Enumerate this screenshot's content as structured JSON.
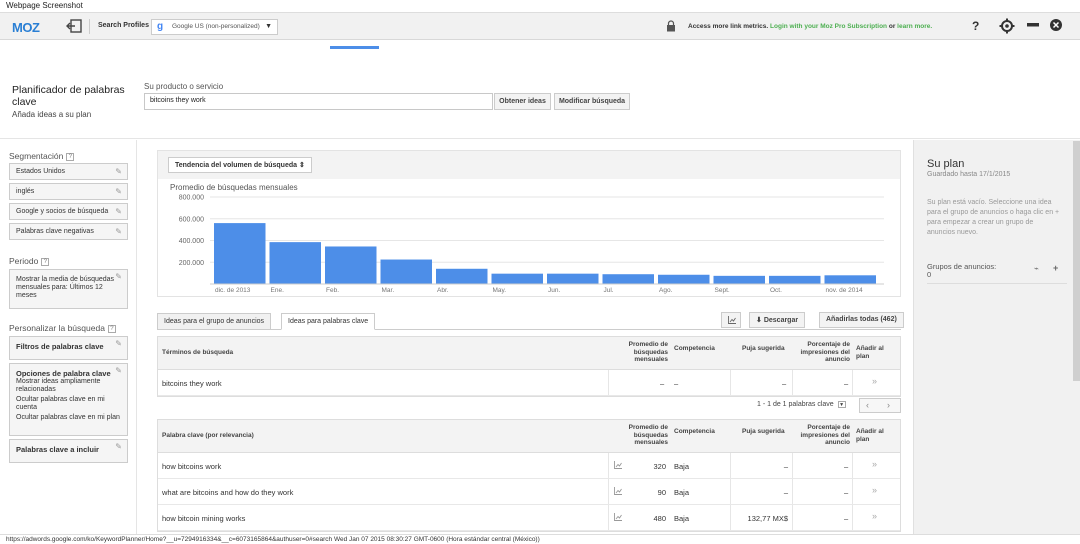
{
  "window": {
    "title": "Webpage Screenshot"
  },
  "moz": {
    "logo": "MOZ",
    "search_profiles_label": "Search Profiles",
    "profile_value": "Google US (non-personalized)",
    "access_prefix": "Access more link metrics.",
    "access_link": "Login with your Moz Pro Subscription",
    "access_or": "or",
    "access_learn": "learn more.",
    "help": "?"
  },
  "header": {
    "planner_title": "Planificador de palabras clave",
    "planner_subtitle": "Añada ideas a su plan",
    "product_label": "Su producto o servicio",
    "product_value": "bitcoins they work",
    "get_ideas": "Obtener ideas",
    "modify_search": "Modificar búsqueda"
  },
  "sidebar": {
    "segmentation_label": "Segmentación",
    "segments": [
      "Estados Unidos",
      "inglés",
      "Google y socios de búsqueda",
      "Palabras clave negativas"
    ],
    "period_label": "Periodo",
    "period_value": "Mostrar la media de búsquedas mensuales para: Últimos 12 meses",
    "customize_label": "Personalizar la búsqueda",
    "keyword_filters": "Filtros de palabras clave",
    "keyword_options": "Opciones de palabra clave",
    "options": [
      "Mostrar ideas ampliamente relacionadas",
      "Ocultar palabras clave en mi cuenta",
      "Ocultar palabras clave en mi plan"
    ],
    "keywords_to_include": "Palabras clave a incluir"
  },
  "chart_panel": {
    "trend_button": "Tendencia del volumen de búsqueda"
  },
  "chart_data": {
    "type": "bar",
    "title": "Promedio de búsquedas mensuales",
    "categories": [
      "dic. de 2013",
      "Ene.",
      "Feb.",
      "Mar.",
      "Abr.",
      "May.",
      "Jun.",
      "Jul.",
      "Ago.",
      "Sept.",
      "Oct.",
      "nov. de 2014"
    ],
    "values": [
      560000,
      385000,
      345000,
      225000,
      140000,
      95000,
      95000,
      90000,
      85000,
      75000,
      75000,
      80000
    ],
    "ylim": [
      0,
      800000
    ],
    "yticks": [
      "800.000",
      "600.000",
      "400.000",
      "200.000"
    ],
    "color": "#4d8ee8",
    "grid": true
  },
  "tabs": {
    "ad_groups": "Ideas para el grupo de anuncios",
    "keyword_ideas": "Ideas para palabras clave",
    "download": "Descargar",
    "add_all": "Añadirlas todas (462)"
  },
  "search_table": {
    "headers": {
      "term": "Términos de búsqueda",
      "avg": "Promedio de búsquedas mensuales",
      "competition": "Competencia",
      "bid": "Puja sugerida",
      "share": "Porcentaje de impresiones del anuncio",
      "add": "Añadir al plan"
    },
    "rows": [
      {
        "keyword": "bitcoins they work",
        "avg": "–",
        "competition": "–",
        "bid": "–",
        "share": "–",
        "add": "»"
      }
    ]
  },
  "pager": {
    "text": "1 - 1 de 1 palabras clave"
  },
  "keyword_table": {
    "headers": {
      "term": "Palabra clave (por relevancia)",
      "avg": "Promedio de búsquedas mensuales",
      "competition": "Competencia",
      "bid": "Puja sugerida",
      "share": "Porcentaje de impresiones del anuncio",
      "add": "Añadir al plan"
    },
    "rows": [
      {
        "keyword": "how bitcoins work",
        "avg": "320",
        "competition": "Baja",
        "bid": "–",
        "share": "–",
        "add": "»"
      },
      {
        "keyword": "what are bitcoins and how do they work",
        "avg": "90",
        "competition": "Baja",
        "bid": "–",
        "share": "–",
        "add": "»"
      },
      {
        "keyword": "how bitcoin mining works",
        "avg": "480",
        "competition": "Baja",
        "bid": "132,77 MX$",
        "share": "–",
        "add": "»"
      }
    ]
  },
  "plan": {
    "title": "Su plan",
    "saved": "Guardado hasta 17/1/2015",
    "empty": "Su plan está vacío. Seleccione una idea para el grupo de anuncios o haga clic en + para empezar a crear un grupo de anuncios nuevo.",
    "groups": "Grupos de anuncios: 0"
  },
  "status": {
    "url": "https://adwords.google.com/ko/KeywordPlanner/Home?__u=7294916334&__c=6073165864&authuser=0#search Wed Jan 07 2015 08:30:27 GMT-0600 (Hora estándar central (México))"
  }
}
